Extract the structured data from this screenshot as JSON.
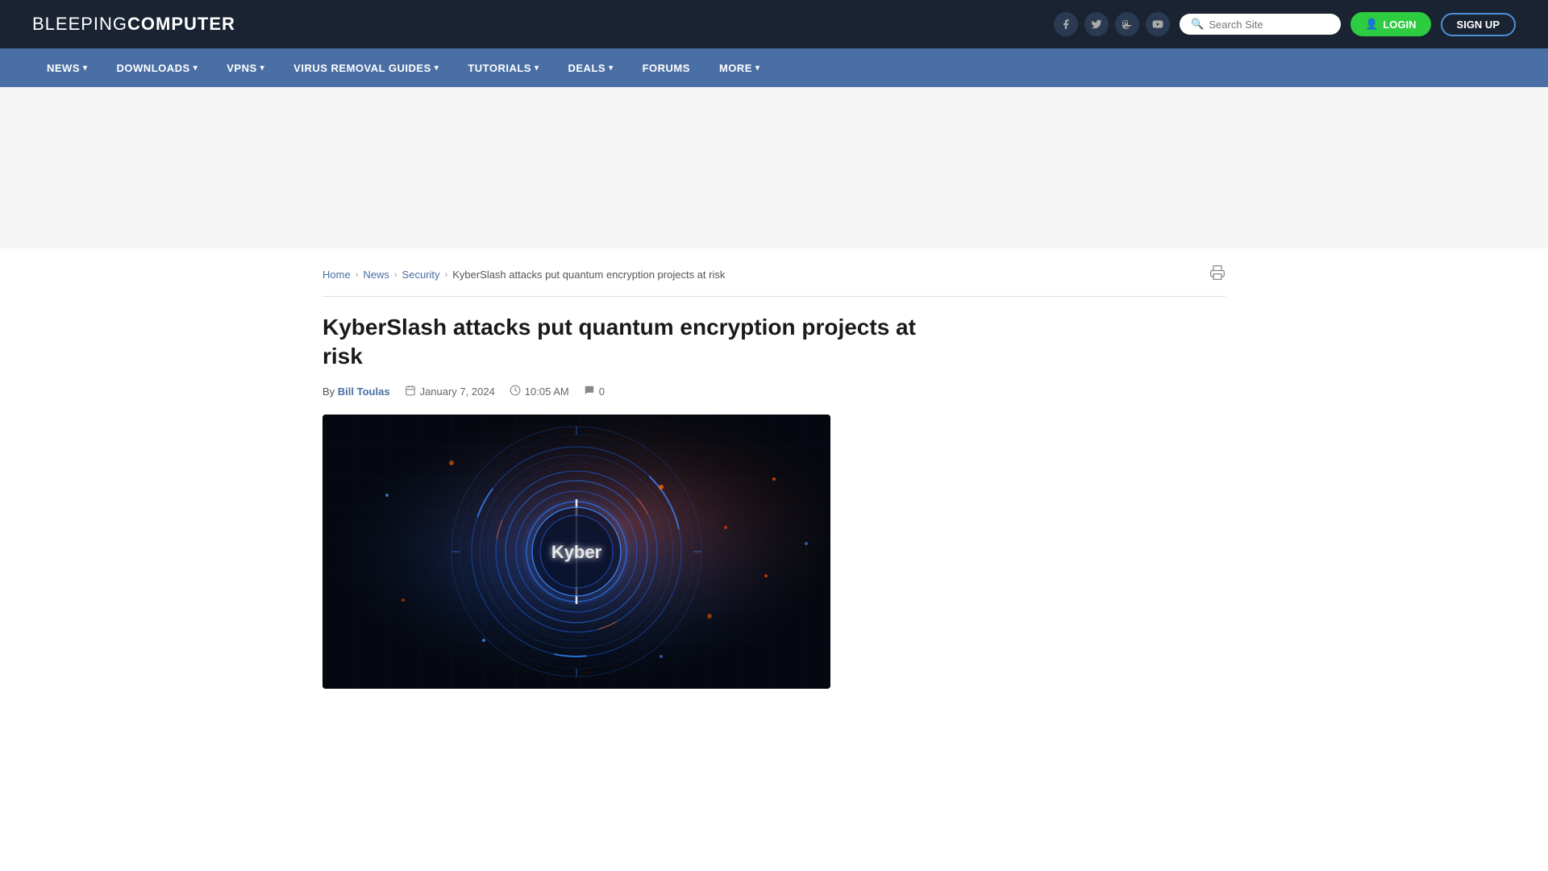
{
  "header": {
    "logo_light": "BLEEPING",
    "logo_bold": "COMPUTER",
    "search_placeholder": "Search Site",
    "login_label": "LOGIN",
    "signup_label": "SIGN UP"
  },
  "nav": {
    "items": [
      {
        "label": "NEWS",
        "has_dropdown": true
      },
      {
        "label": "DOWNLOADS",
        "has_dropdown": true
      },
      {
        "label": "VPNS",
        "has_dropdown": true
      },
      {
        "label": "VIRUS REMOVAL GUIDES",
        "has_dropdown": true
      },
      {
        "label": "TUTORIALS",
        "has_dropdown": true
      },
      {
        "label": "DEALS",
        "has_dropdown": true
      },
      {
        "label": "FORUMS",
        "has_dropdown": false
      },
      {
        "label": "MORE",
        "has_dropdown": true
      }
    ]
  },
  "breadcrumb": {
    "home": "Home",
    "news": "News",
    "security": "Security",
    "current": "KyberSlash attacks put quantum encryption projects at risk"
  },
  "article": {
    "title": "KyberSlash attacks put quantum encryption projects at risk",
    "author_prefix": "By",
    "author_name": "Bill Toulas",
    "date": "January 7, 2024",
    "time": "10:05 AM",
    "comments": "0"
  },
  "social": {
    "facebook": "f",
    "twitter": "𝕏",
    "mastodon": "M",
    "youtube": "▶"
  },
  "colors": {
    "nav_bg": "#4a6fa5",
    "header_bg": "#1a2332",
    "link_color": "#4a6fa5",
    "login_bg": "#2ecc40",
    "signup_border": "#4a90d9"
  }
}
